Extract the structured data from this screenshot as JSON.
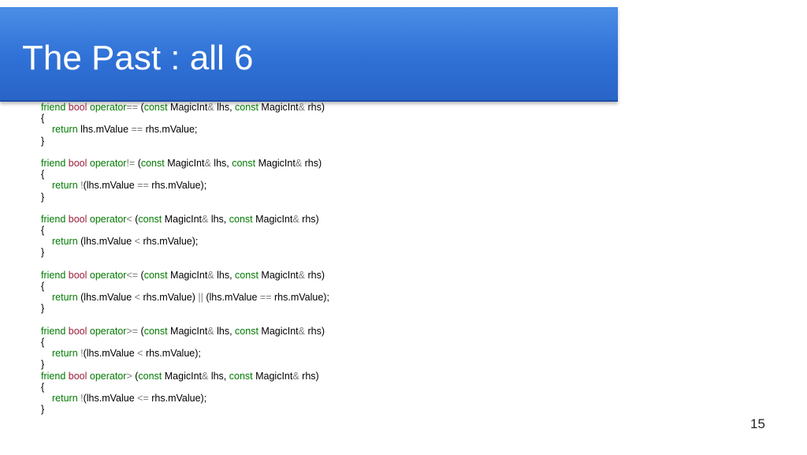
{
  "slide": {
    "title": "The Past : all 6",
    "page_number": "15"
  },
  "colors": {
    "title_bar": "#3a7ee0",
    "keyword": "#007a00",
    "type": "#9b1f3a",
    "operator": "#7a7a7a"
  },
  "code_blocks": [
    {
      "signature": [
        "friend",
        " ",
        "bool",
        " operator",
        "==",
        " (",
        "const",
        " MagicInt",
        "&",
        " lhs, ",
        "const",
        " MagicInt",
        "&",
        " rhs)"
      ],
      "open": "{",
      "body": [
        "return",
        " lhs.mValue ",
        "==",
        " rhs.mValue;"
      ],
      "close": "}"
    },
    {
      "signature": [
        "friend",
        " ",
        "bool",
        " operator",
        "!=",
        " (",
        "const",
        " MagicInt",
        "&",
        " lhs, ",
        "const",
        " MagicInt",
        "&",
        " rhs)"
      ],
      "open": "{",
      "body": [
        "return",
        " !",
        "(lhs.mValue ",
        "==",
        " rhs.mValue);"
      ],
      "close": "}"
    },
    {
      "signature": [
        "friend",
        " ",
        "bool",
        " operator",
        "<",
        " (",
        "const",
        " MagicInt",
        "&",
        " lhs, ",
        "const",
        " MagicInt",
        "&",
        " rhs)"
      ],
      "open": "{",
      "body": [
        "return",
        " (lhs.mValue ",
        "<",
        " rhs.mValue);"
      ],
      "close": "}"
    },
    {
      "signature": [
        "friend",
        " ",
        "bool",
        " operator",
        "<=",
        " (",
        "const",
        " MagicInt",
        "&",
        " lhs, ",
        "const",
        " MagicInt",
        "&",
        " rhs)"
      ],
      "open": "{",
      "body": [
        "return",
        " (lhs.mValue ",
        "<",
        " rhs.mValue) ",
        "||",
        " (lhs.mValue ",
        "==",
        " rhs.mValue);"
      ],
      "close": "}"
    },
    {
      "signature": [
        "friend",
        " ",
        "bool",
        " operator",
        ">=",
        " (",
        "const",
        " MagicInt",
        "&",
        " lhs, ",
        "const",
        " MagicInt",
        "&",
        " rhs)"
      ],
      "open": "{",
      "body": [
        "return",
        " !",
        "(lhs.mValue ",
        "<",
        " rhs.mValue);"
      ],
      "close": "}"
    },
    {
      "signature": [
        "friend",
        " ",
        "bool",
        " operator",
        ">",
        " (",
        "const",
        " MagicInt",
        "&",
        " lhs, ",
        "const",
        " MagicInt",
        "&",
        " rhs)"
      ],
      "open": "{",
      "body": [
        "return",
        " !",
        "(lhs.mValue ",
        "<=",
        " rhs.mValue);"
      ],
      "close": "}"
    }
  ]
}
